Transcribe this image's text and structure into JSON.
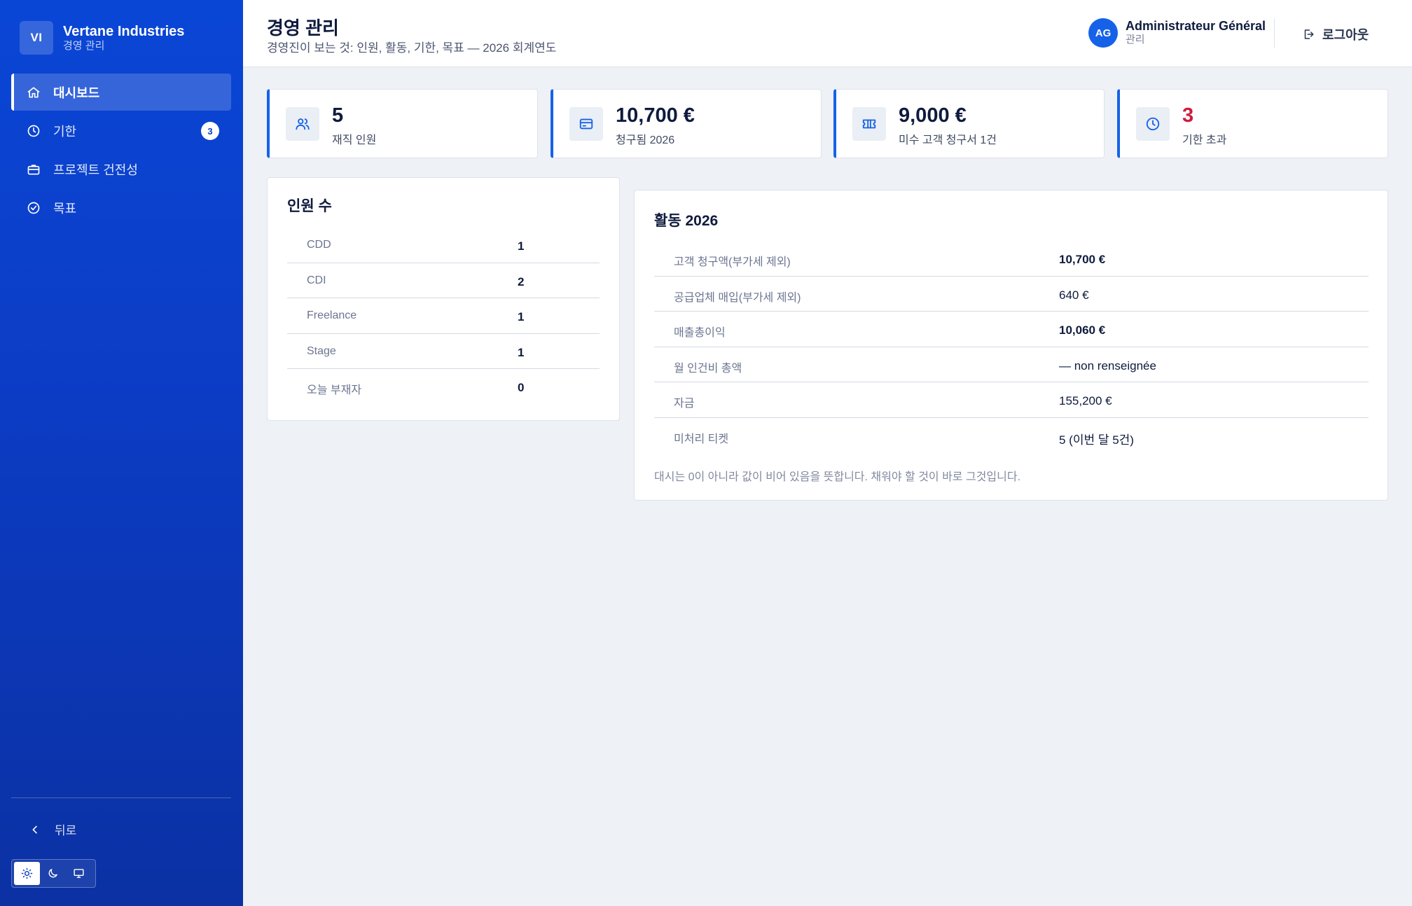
{
  "brand": {
    "initials": "VI",
    "name": "Vertane Industries",
    "subtitle": "경영 관리"
  },
  "sidebar": {
    "items": [
      {
        "label": "대시보드",
        "icon": "home-icon",
        "active": true
      },
      {
        "label": "기한",
        "icon": "clock-icon",
        "badge": "3"
      },
      {
        "label": "프로젝트 건전성",
        "icon": "briefcase-icon"
      },
      {
        "label": "목표",
        "icon": "check-circle-icon"
      }
    ],
    "back_label": "뒤로",
    "theme_options": [
      "sun-icon",
      "moon-icon",
      "monitor-icon"
    ]
  },
  "header": {
    "title": "경영 관리",
    "subtitle": "경영진이 보는 것: 인원, 활동, 기한, 목표 — 2026 회계연도",
    "user": {
      "initials": "AG",
      "name": "Administrateur Général",
      "role": "관리"
    },
    "logout_label": "로그아웃"
  },
  "stats": [
    {
      "icon": "users-icon",
      "value": "5",
      "label": "재직 인원"
    },
    {
      "icon": "credit-card-icon",
      "value": "10,700 €",
      "label": "청구됨 2026"
    },
    {
      "icon": "ticket-icon",
      "value": "9,000 €",
      "label": "미수 고객 청구서 1건"
    },
    {
      "icon": "clock-icon",
      "value": "3",
      "label": "기한 초과",
      "danger": true
    }
  ],
  "headcount": {
    "title": "인원 수",
    "rows": [
      {
        "label": "CDD",
        "value": "1"
      },
      {
        "label": "CDI",
        "value": "2"
      },
      {
        "label": "Freelance",
        "value": "1"
      },
      {
        "label": "Stage",
        "value": "1"
      },
      {
        "label": "오늘 부재자",
        "value": "0"
      }
    ]
  },
  "activity": {
    "title": "활동 2026",
    "rows": [
      {
        "label": "고객 청구액(부가세 제외)",
        "value": "10,700 €",
        "bold": true
      },
      {
        "label": "공급업체 매입(부가세 제외)",
        "value": "640 €"
      },
      {
        "label": "매출총이익",
        "value": "10,060 €",
        "bold": true
      },
      {
        "label": "월 인건비 총액",
        "value": "— non renseignée"
      },
      {
        "label": "자금",
        "value": "155,200 €"
      },
      {
        "label": "미처리 티켓",
        "value": "5 (이번 달 5건)"
      }
    ],
    "note": "대시는 0이 아니라 값이 비어 있음을 뜻합니다. 채워야 할 것이 바로 그것입니다."
  },
  "colors": {
    "sidebar_top": "#0a46d6",
    "sidebar_bottom": "#0b31a3",
    "accent": "#1562e8",
    "danger": "#d01a3a"
  }
}
